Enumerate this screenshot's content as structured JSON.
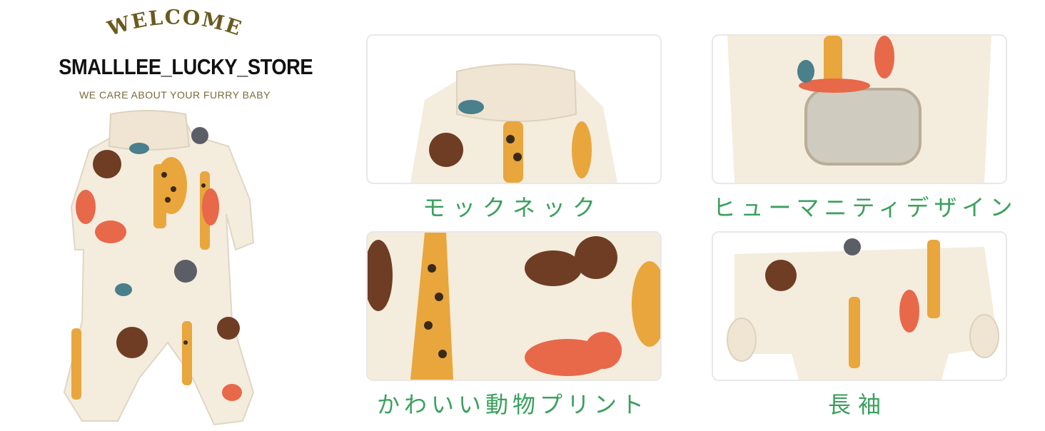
{
  "brand": {
    "welcome": "WELCOME",
    "store_name": "SMALLLEE_LUCKY_STORE",
    "tagline": "WE CARE ABOUT YOUR FURRY BABY"
  },
  "features": [
    {
      "caption": "モックネック"
    },
    {
      "caption": "ヒューマニティデザイン"
    },
    {
      "caption": "かわいい動物プリント"
    },
    {
      "caption": "長袖"
    }
  ],
  "colors": {
    "fabric": "#f4ecdd",
    "caption": "#3aa05c",
    "brand_gold": "#6b5a1e",
    "giraffe": "#e8a63c",
    "tiger": "#e8684a",
    "lion": "#6e3d24",
    "koala": "#5b5e66",
    "turtle": "#4a7f8c"
  }
}
